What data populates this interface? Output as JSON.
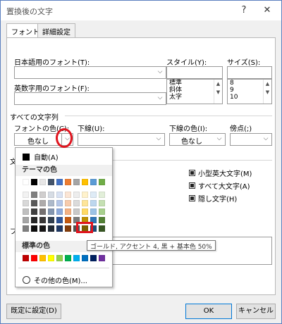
{
  "window": {
    "title": "置換後の文字",
    "help": "?",
    "close": "✕"
  },
  "tabs": [
    {
      "label": "フォント"
    },
    {
      "label": "詳細設定"
    }
  ],
  "fonts": {
    "japanese_label": "日本語用のフォント(T):",
    "latin_label": "英数字用のフォント(F):",
    "style_label": "スタイル(Y):",
    "size_label": "サイズ(S):",
    "styles": [
      "標準",
      "斜体",
      "太字"
    ],
    "sizes": [
      "8",
      "9",
      "10"
    ]
  },
  "all_text": {
    "section": "すべての文字列",
    "font_color_label": "フォントの色(C):",
    "font_color_value": "色なし",
    "underline_label": "下線(U):",
    "underline_color_label": "下線の色(I):",
    "underline_color_value": "色なし",
    "emphasis_label": "傍点(;)",
    "effects_partial": "文"
  },
  "effects": [
    {
      "label": "小型英大文字(M)"
    },
    {
      "label": "すべて大文字(A)"
    },
    {
      "label": "隠し文字(H)"
    }
  ],
  "preview_partial": "プ",
  "buttons": {
    "default": "既定に設定(D)",
    "ok": "OK",
    "cancel": "キャンセル"
  },
  "color_dropdown": {
    "auto_label": "自動(A)",
    "theme_header": "テーマの色",
    "standard_header": "標準の色",
    "more_colors": "その他の色(M)...",
    "tooltip": "ゴールド, アクセント 4, 黒 + 基本色 50%",
    "theme_rows": [
      [
        "#ffffff",
        "#000000",
        "#e7e6e6",
        "#44546a",
        "#4472c4",
        "#ed7d31",
        "#a5a5a5",
        "#ffc000",
        "#5b9bd5",
        "#70ad47"
      ],
      [
        "#f2f2f2",
        "#7f7f7f",
        "#d0cece",
        "#d6dce4",
        "#d9e2f3",
        "#fbe5d5",
        "#ededed",
        "#fff2cc",
        "#deebf6",
        "#e2efd9"
      ],
      [
        "#d8d8d8",
        "#595959",
        "#aeabab",
        "#adb9ca",
        "#b4c6e7",
        "#f7cbac",
        "#dbdbdb",
        "#fee599",
        "#bdd7ee",
        "#c5e0b3"
      ],
      [
        "#bfbfbf",
        "#3f3f3f",
        "#757070",
        "#8496b0",
        "#8eaadb",
        "#f4b183",
        "#c9c9c9",
        "#ffd965",
        "#9cc3e5",
        "#a8d08d"
      ],
      [
        "#a5a5a5",
        "#262626",
        "#3a3838",
        "#323f4f",
        "#2f5496",
        "#c55a11",
        "#7b7b7b",
        "#bf9000",
        "#2e75b5",
        "#538135"
      ],
      [
        "#7f7f7f",
        "#0c0c0c",
        "#171616",
        "#222a35",
        "#1f3864",
        "#833c0b",
        "#525252",
        "#7f6000",
        "#1e4e79",
        "#375623"
      ]
    ],
    "standard_colors": [
      "#c00000",
      "#ff0000",
      "#ffc000",
      "#ffff00",
      "#92d050",
      "#00b050",
      "#00b0f0",
      "#0070c0",
      "#002060",
      "#7030a0"
    ]
  }
}
